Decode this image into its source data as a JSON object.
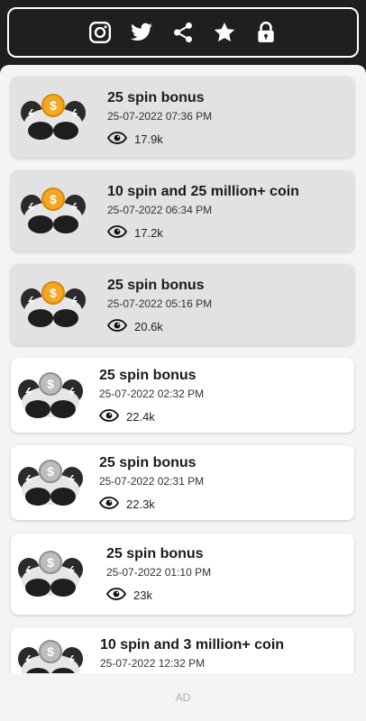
{
  "toolbar": {
    "icons": [
      "instagram-icon",
      "twitter-icon",
      "share-icon",
      "star-icon",
      "lock-icon"
    ],
    "icon_color": "#ffffff",
    "background": "#1f1f1f"
  },
  "posts": [
    {
      "title": "25 spin bonus",
      "date": "25-07-2022 07:36 PM",
      "views": "17.9k",
      "read": true,
      "coin": "gold"
    },
    {
      "title": "10 spin and 25 million+ coin",
      "date": "25-07-2022 06:34 PM",
      "views": "17.2k",
      "read": true,
      "coin": "gold"
    },
    {
      "title": "25 spin bonus",
      "date": "25-07-2022 05:16 PM",
      "views": "20.6k",
      "read": true,
      "coin": "gold"
    },
    {
      "title": "25 spin bonus",
      "date": "25-07-2022 02:32 PM",
      "views": "22.4k",
      "read": false,
      "coin": "silver"
    },
    {
      "title": "25 spin bonus",
      "date": "25-07-2022 02:31 PM",
      "views": "22.3k",
      "read": false,
      "coin": "silver"
    },
    {
      "title": "25 spin bonus",
      "date": "25-07-2022 01:10 PM",
      "views": "23k",
      "read": false,
      "coin": "silver"
    },
    {
      "title": "10 spin and 3 million+ coin",
      "date": "25-07-2022 12:32 PM",
      "views": "",
      "read": false,
      "coin": "silver"
    }
  ],
  "ad": {
    "label": "AD"
  },
  "colors": {
    "read_card": "#e2e2e2",
    "unread_card": "#ffffff",
    "gold_coin": "#f5a623",
    "silver_coin": "#bdbdbd"
  }
}
